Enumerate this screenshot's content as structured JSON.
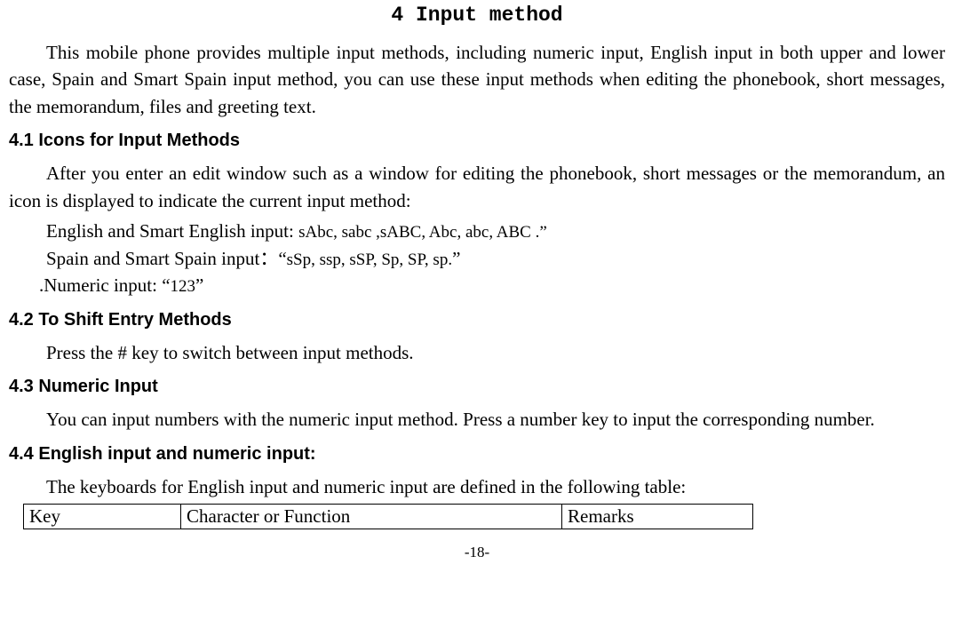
{
  "title": "4  Input method",
  "intro": "This mobile phone provides multiple input methods, including numeric input, English input in both upper and lower case, Spain and Smart Spain input method, you can use these input methods when editing the phonebook, short messages, the memorandum, files and greeting text.",
  "section41": {
    "heading": "4.1   Icons for Input Methods",
    "para1": "After you enter an edit window such as a window for editing the phonebook, short messages or the memorandum, an icon is displayed to indicate the current input method:",
    "line1a": "English and Smart English input: ",
    "line1b": "sAbc, sabc ,sABC, Abc, abc, ABC .”",
    "line2a": "Spain and Smart Spain input：“",
    "line2b": "sSp, ssp, sSP, Sp, SP, sp.",
    "line2c": "”",
    "line3a": ".Numeric input: “",
    "line3b": "123",
    "line3c": "”"
  },
  "section42": {
    "heading": "4.2   To Shift Entry Methods",
    "para": "Press the # key to switch between input methods."
  },
  "section43": {
    "heading": "4.3   Numeric Input",
    "para": "You can input numbers with the numeric input method. Press a number key to input the corresponding number."
  },
  "section44": {
    "heading": "4.4   English input and numeric input:",
    "para": "The keyboards for English input and numeric input are defined in the following table:"
  },
  "table": {
    "headers": {
      "key": "Key",
      "char": "Character or Function",
      "remarks": "Remarks"
    }
  },
  "pageNumber": "-18-"
}
